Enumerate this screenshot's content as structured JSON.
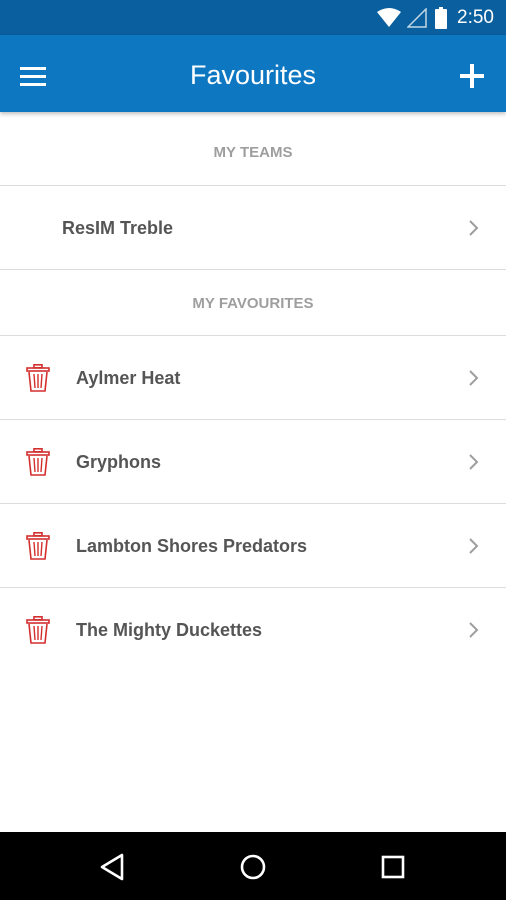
{
  "status": {
    "time": "2:50"
  },
  "app_bar": {
    "title": "Favourites"
  },
  "sections": {
    "my_teams": {
      "title": "MY TEAMS",
      "items": [
        {
          "label": "ResIM Treble"
        }
      ]
    },
    "my_favourites": {
      "title": "MY FAVOURITES",
      "items": [
        {
          "label": "Aylmer Heat"
        },
        {
          "label": "Gryphons"
        },
        {
          "label": "Lambton Shores Predators"
        },
        {
          "label": "The Mighty Duckettes"
        }
      ]
    }
  },
  "colors": {
    "status_bar": "#0a5f9e",
    "app_bar": "#0d77c2",
    "trash_icon": "#d32f2f",
    "section_header_text": "#9e9e9e",
    "item_text": "#555555"
  },
  "icons": {
    "menu": "menu-icon",
    "add": "plus-icon",
    "delete": "trash-icon",
    "row_arrow": "chevron-right-icon",
    "nav_back": "back-triangle-icon",
    "nav_home": "home-circle-icon",
    "nav_recents": "recents-square-icon"
  }
}
